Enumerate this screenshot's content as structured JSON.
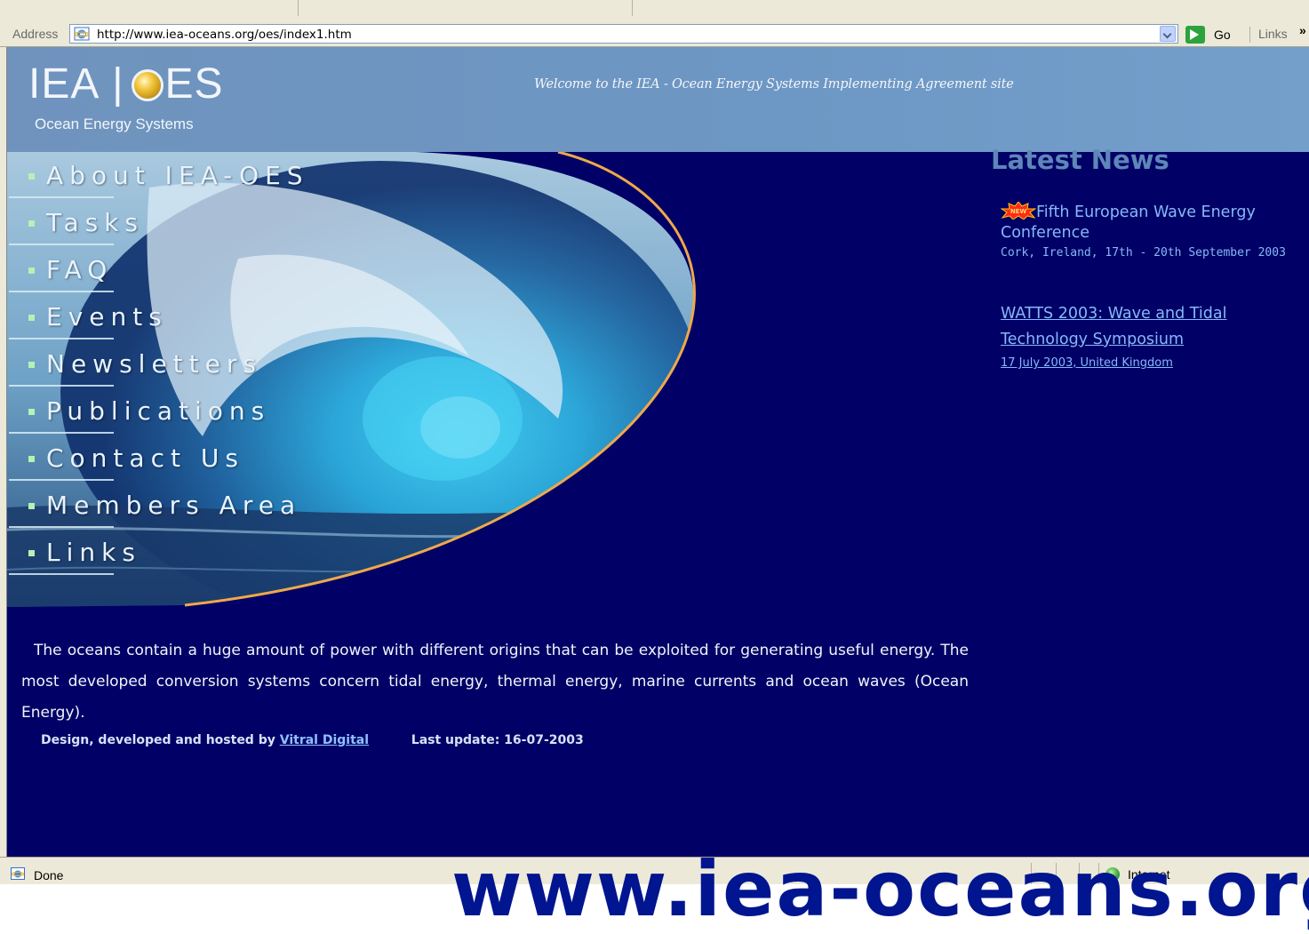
{
  "browser": {
    "address_label": "Address",
    "url": "http://www.iea-oceans.org/oes/index1.htm",
    "go_label": "Go",
    "links_label": "Links",
    "links_more": "»",
    "status_text": "Done",
    "zone_text": "Internet"
  },
  "header": {
    "logo_left": "IEA",
    "logo_bar": "|",
    "logo_right": "ES",
    "logo_subtitle": "Ocean Energy Systems",
    "welcome": "Welcome to the IEA - Ocean Energy Systems Implementing Agreement site"
  },
  "nav": {
    "items": [
      {
        "label": "About IEA-OES"
      },
      {
        "label": "Tasks"
      },
      {
        "label": "FAQ"
      },
      {
        "label": "Events"
      },
      {
        "label": "Newsletters"
      },
      {
        "label": "Publications"
      },
      {
        "label": "Contact Us"
      },
      {
        "label": "Members Area"
      },
      {
        "label": "Links"
      }
    ]
  },
  "news": {
    "title": "Latest News",
    "badge": "NEW",
    "item1_title": "Fifth European Wave Energy Conference",
    "item1_sub": "Cork, Ireland, 17th - 20th September 2003",
    "item2_title": "WATTS 2003: Wave and Tidal Technology Symposium",
    "item2_sub": "17 July 2003, United Kingdom"
  },
  "body": {
    "intro": "The oceans contain a huge amount of power with different origins that can be exploited for generating useful energy. The most developed conversion systems concern tidal energy, thermal energy, marine currents and ocean waves (Ocean Energy).",
    "credits_prefix": "Design, developed and hosted by",
    "credits_link": "Vitral Digital",
    "last_update": "Last update: 16-07-2003"
  },
  "watermark": "www.iea-oceans.org",
  "colors": {
    "page_bg": "#000066",
    "header_bg": "#6d97c4",
    "news_link": "#87b8f8",
    "news_title": "#5f86b8",
    "nav_bullet": "#b5f2b3",
    "wave_curve": "#f0a84a",
    "watermark": "#00158f"
  },
  "icons": [
    "ie-page-icon",
    "dropdown-arrow-icon",
    "go-arrow-icon",
    "logo-globe-icon",
    "new-badge-icon",
    "nav-bullet-icon",
    "status-page-icon",
    "internet-zone-icon"
  ]
}
